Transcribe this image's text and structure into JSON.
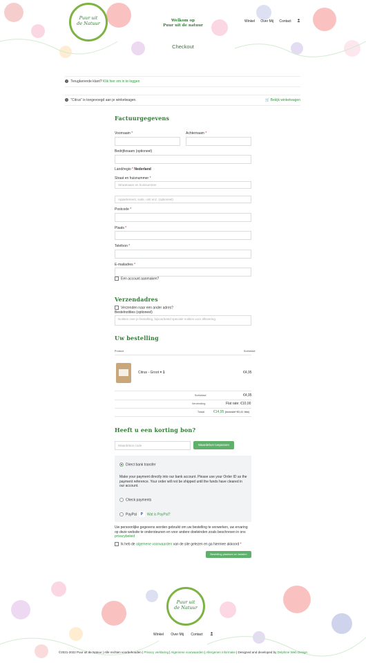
{
  "header": {
    "logo_line1": "Puur uit",
    "logo_line2": "de Natuur",
    "tagline_line1": "Welkom op",
    "tagline_line2": "Puur uit de natuur",
    "nav": [
      "Winkel",
      "Over Mij",
      "Contact"
    ]
  },
  "page_title": "Checkout",
  "notices": {
    "returning_text": "Terugkerende klant?",
    "returning_link": "Klik hier om in te loggen",
    "cart_text": "“Citrus” is toegevoegd aan je winkelwagen.",
    "cart_link": "Bekijk winkelwagen"
  },
  "billing": {
    "heading": "Factuurgegevens",
    "first_name": "Voornaam",
    "last_name": "Achternaam",
    "company": "Bedrijfsnaam (optioneel)",
    "country_label": "Land/regio",
    "country_value": "Nederland",
    "street_label": "Straat en huisnummer",
    "street_placeholder": "Straatnaam en huisnummer",
    "street2_placeholder": "Appartement, suite, unit enz. (optioneel)",
    "postcode": "Postcode",
    "city": "Plaats",
    "phone": "Telefoon",
    "email": "E-mailadres",
    "create_account": "Een account aanmaken?",
    "required_mark": "*"
  },
  "shipping": {
    "heading": "Verzendadres",
    "ship_different": "Verzenden naar een ander adres?",
    "notes_label": "Bestelnotities (optioneel)",
    "notes_placeholder": "Notities over je bestelling, bijvoorbeeld speciale notities voor aflevering."
  },
  "order": {
    "heading": "Uw bestelling",
    "col_product": "Product",
    "col_subtotal": "Subtotaal",
    "product_name": "Citrus - Groot",
    "product_qty": "× 1",
    "product_price": "€4,95",
    "subtotal_label": "Subtotaal",
    "subtotal_value": "€4,95",
    "shipping_label": "Verzending",
    "shipping_value": "Flat rate: €10,00",
    "total_label": "Totaal",
    "total_value": "€14,95",
    "total_tax": "(inclusief €0,41 btw)"
  },
  "coupon": {
    "heading": "Heeft u een korting bon?",
    "placeholder": "Waardebon code",
    "button": "Waardebon toepassen"
  },
  "payment": {
    "bank_label": "Direct bank transfer",
    "bank_desc": "Make your payment directly into our bank account. Please use your Order ID as the payment reference. Your order will not be shipped until the funds have cleared in our account.",
    "check_label": "Check payments",
    "paypal_label": "PayPal",
    "paypal_link": "Wat is PayPal?"
  },
  "privacy": {
    "text": "Uw persoonlijke gegevens worden gebruikt om uw bestelling te verwerken, uw ervaring op deze website te ondersteunen en voor andere doeleinden zoals beschreven in ons",
    "link": "privacybeleid",
    "terms_pre": "Ik heb de",
    "terms_link": "algemene voorwaarden",
    "terms_post": "van de site gelezen en ga hiermee akkoord",
    "place_order": "Bestelling plaatsen en betalen"
  },
  "footer": {
    "nav": [
      "Winkel",
      "Over Mij",
      "Contact"
    ],
    "copyright": "©2021-2022 Puur uit de Natuur | Alle rechten voorbehouden |",
    "links": [
      "Privacy verklaring",
      "Algemene voorwaarden",
      "Allergenen informatie"
    ],
    "designed_by": "| Designed and developed by",
    "designer": "Delphine Web Design"
  },
  "colors": {
    "brand_green": "#2e7d32",
    "link_green": "#2e9a3e",
    "button_green": "#5fb06a"
  }
}
